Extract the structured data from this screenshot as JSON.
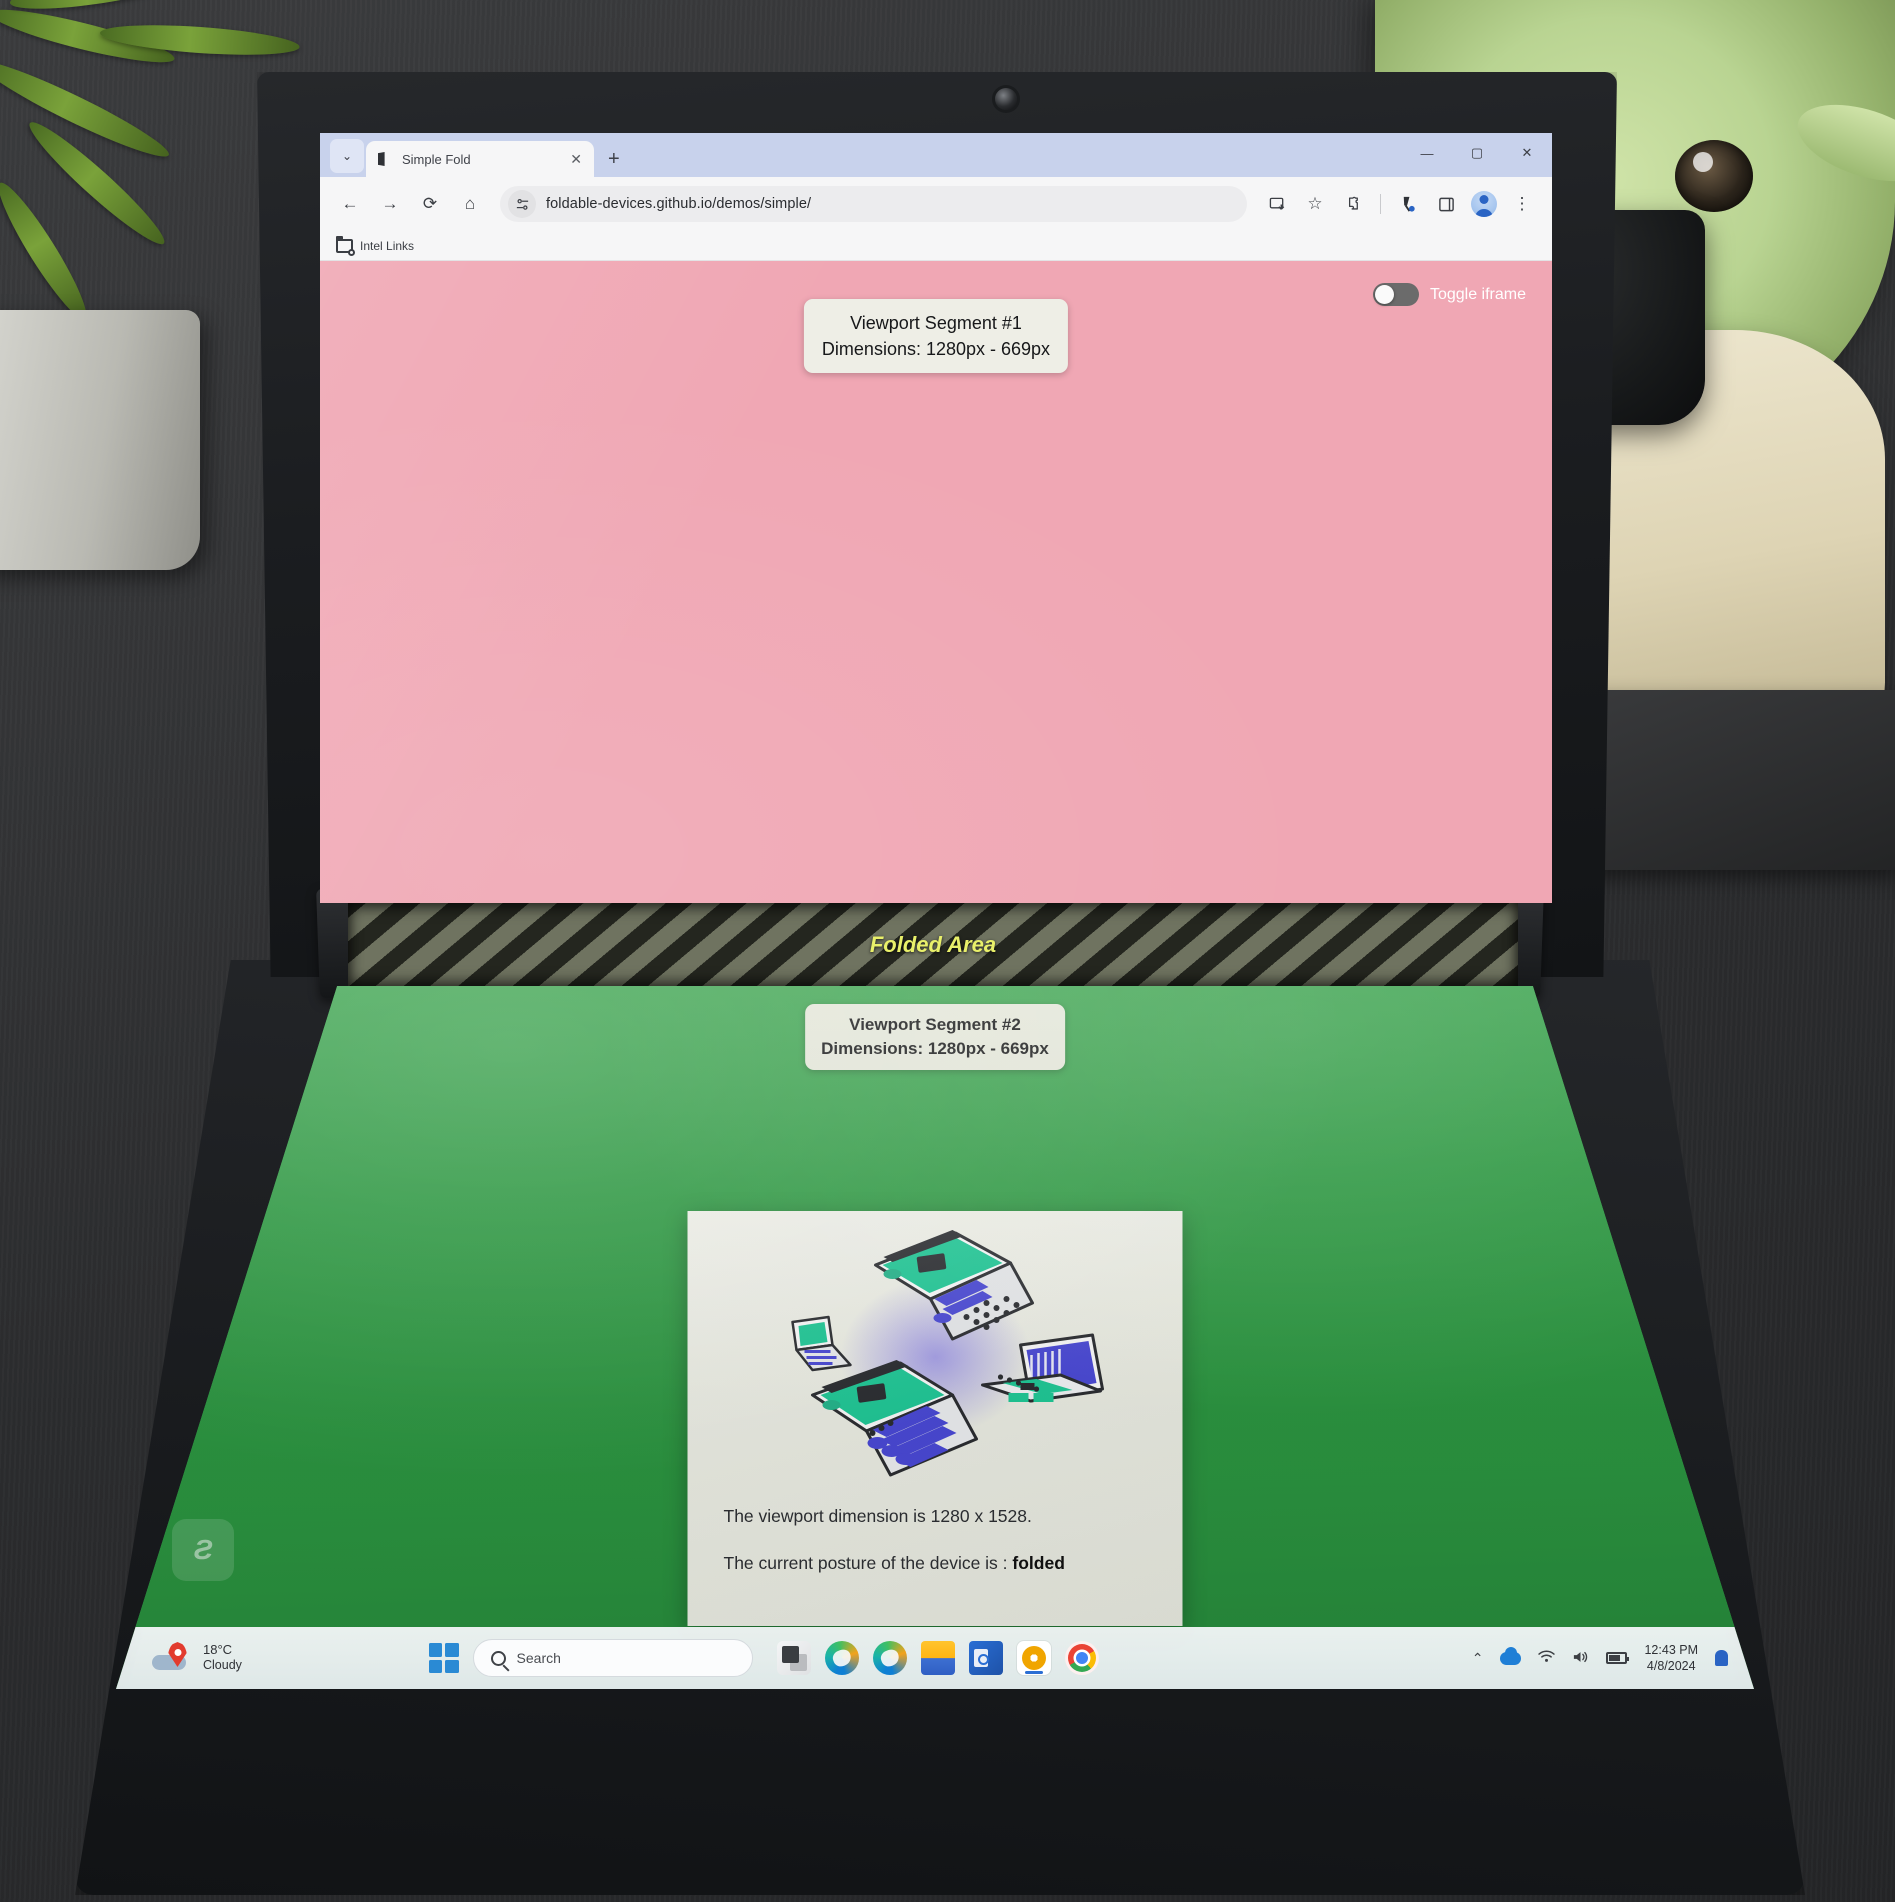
{
  "browser": {
    "tab": {
      "title": "Simple Fold",
      "close_label": "✕",
      "favicon": "book-icon"
    },
    "new_tab_label": "+",
    "tab_search_label": "⌄",
    "window_controls": {
      "minimize": "—",
      "maximize": "▢",
      "close": "✕"
    },
    "nav": {
      "back": "←",
      "forward": "→",
      "reload": "⟳",
      "home": "⌂"
    },
    "omnibox": {
      "site_settings_icon": "tune-icon",
      "url": "foldable-devices.github.io/demos/simple/"
    },
    "toolbar_right": {
      "install": "install-icon",
      "bookmark_star": "☆",
      "extensions": "extensions-icon",
      "split_screen": "split-screen-icon",
      "side_panel": "side-panel-icon",
      "profile": "profile-avatar"
    },
    "bookmarks": [
      {
        "label": "Intel Links",
        "icon": "managed-folder-icon"
      }
    ]
  },
  "page": {
    "segment1": {
      "title": "Viewport Segment #1",
      "dimensions": "Dimensions: 1280px - 669px",
      "background_color": "#f0a7b4"
    },
    "toggle_iframe": {
      "label": "Toggle iframe",
      "state": "off"
    },
    "fold": {
      "label": "Folded Area"
    },
    "segment2": {
      "title": "Viewport Segment #2",
      "dimensions": "Dimensions: 1280px - 669px",
      "background_color": "#2f9c44"
    },
    "card": {
      "illustration_alt": "foldable-laptops-illustration",
      "line1": "The viewport dimension is 1280 x 1528.",
      "line2_prefix": "The current posture of the device is : ",
      "line2_value": "folded"
    }
  },
  "taskbar": {
    "weather": {
      "temperature": "18°C",
      "condition": "Cloudy"
    },
    "start_label": "start-button",
    "search": {
      "placeholder": "Search",
      "value": ""
    },
    "apps": [
      {
        "name": "task-view"
      },
      {
        "name": "microsoft-edge"
      },
      {
        "name": "microsoft-edge-dev"
      },
      {
        "name": "file-explorer"
      },
      {
        "name": "outlook"
      },
      {
        "name": "chrome-canary"
      },
      {
        "name": "google-chrome"
      }
    ],
    "tray": {
      "overflow": "⌃",
      "onedrive": "onedrive-icon",
      "wifi": "wifi-icon",
      "volume": "volume-icon",
      "battery": "battery-icon",
      "time": "12:43 PM",
      "date": "4/8/2024",
      "notifications": "bell-icon"
    }
  }
}
